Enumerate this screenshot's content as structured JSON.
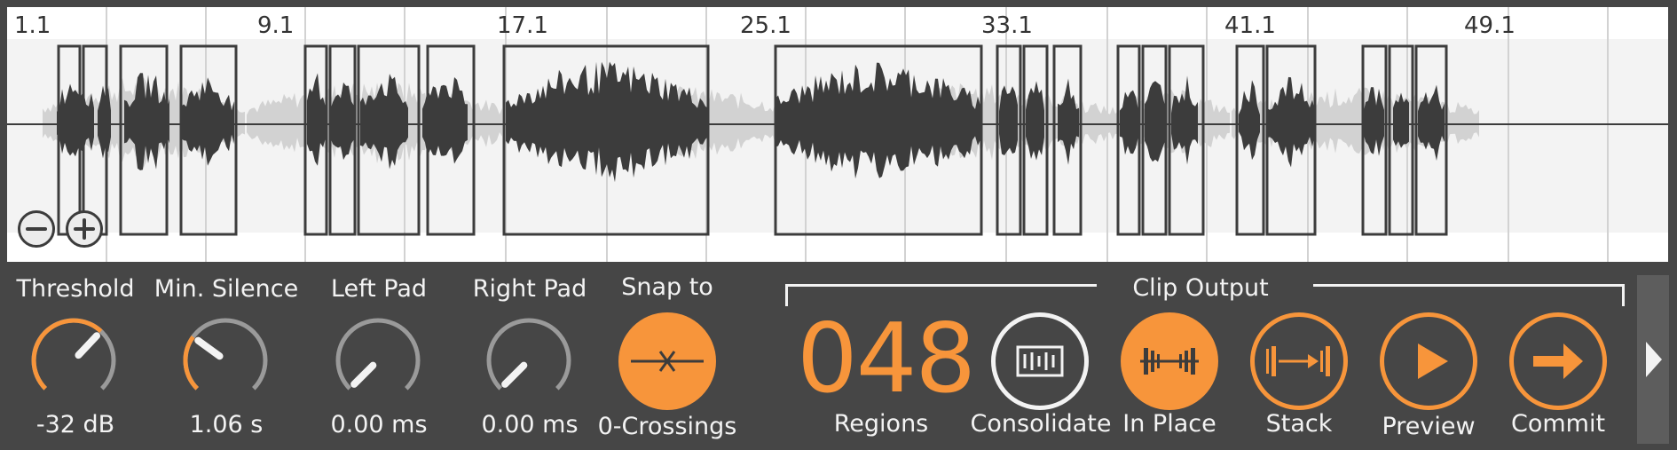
{
  "timeline": {
    "bar_labels": [
      "1.1",
      "9.1",
      "17.1",
      "25.1",
      "33.1",
      "41.1",
      "49.1"
    ],
    "zoom_out_icon": "minus-icon",
    "zoom_in_icon": "plus-icon"
  },
  "controls": {
    "threshold": {
      "label": "Threshold",
      "value": "-32 dB",
      "fraction": 0.66
    },
    "min_silence": {
      "label": "Min. Silence",
      "value": "1.06 s",
      "fraction": 0.3
    },
    "left_pad": {
      "label": "Left Pad",
      "value": "0.00 ms",
      "fraction": 0.0
    },
    "right_pad": {
      "label": "Right Pad",
      "value": "0.00 ms",
      "fraction": 0.0
    },
    "snap": {
      "label": "Snap to",
      "value": "0-Crossings",
      "icon": "zero-crossing-icon"
    }
  },
  "clip_output": {
    "header": "Clip Output",
    "region_count": "048",
    "regions_label": "Regions",
    "consolidate_label": "Consolidate",
    "in_place_label": "In Place",
    "stack_label": "Stack",
    "preview_label": "Preview",
    "commit_label": "Commit"
  },
  "colors": {
    "accent": "#f7953b",
    "panel_bg": "#464646",
    "knob_track": "#9a9a9a",
    "waveform": "#3c3c3c",
    "waveform_faded": "#cfcfcf"
  }
}
